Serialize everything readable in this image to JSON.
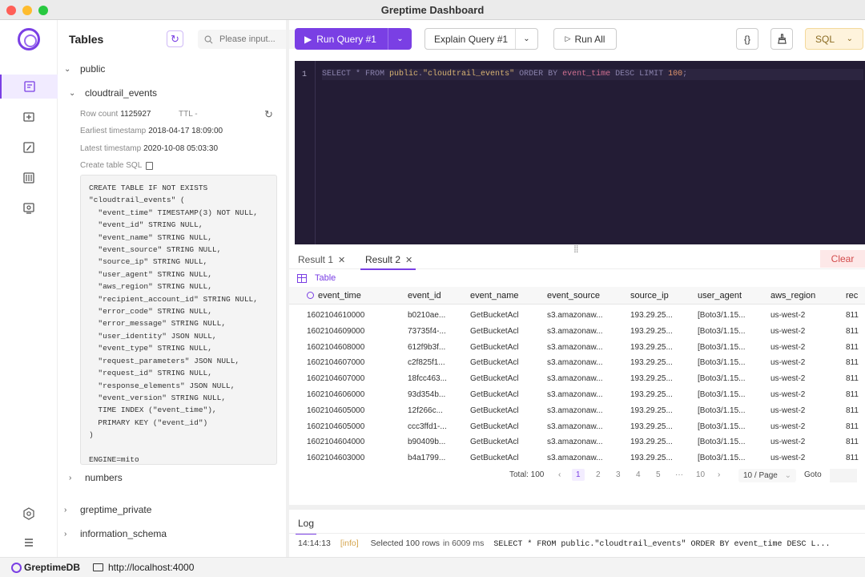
{
  "window": {
    "title": "Greptime Dashboard"
  },
  "sidebar": {
    "title": "Tables",
    "search_placeholder": "Please input...",
    "db_public": "public",
    "table_name": "cloudtrail_events",
    "row_count_label": "Row count",
    "row_count": "1125927",
    "ttl_label": "TTL",
    "ttl": "-",
    "earliest_label": "Earliest timestamp",
    "earliest": "2018-04-17 18:09:00",
    "latest_label": "Latest timestamp",
    "latest": "2020-10-08 05:03:30",
    "create_sql_label": "Create table SQL",
    "create_sql": "CREATE TABLE IF NOT EXISTS\n\"cloudtrail_events\" (\n  \"event_time\" TIMESTAMP(3) NOT NULL,\n  \"event_id\" STRING NULL,\n  \"event_name\" STRING NULL,\n  \"event_source\" STRING NULL,\n  \"source_ip\" STRING NULL,\n  \"user_agent\" STRING NULL,\n  \"aws_region\" STRING NULL,\n  \"recipient_account_id\" STRING NULL,\n  \"error_code\" STRING NULL,\n  \"error_message\" STRING NULL,\n  \"user_identity\" JSON NULL,\n  \"event_type\" STRING NULL,\n  \"request_parameters\" JSON NULL,\n  \"request_id\" STRING NULL,\n  \"response_elements\" JSON NULL,\n  \"event_version\" STRING NULL,\n  TIME INDEX (\"event_time\"),\n  PRIMARY KEY (\"event_id\")\n)\n\nENGINE=mito",
    "table_numbers": "numbers",
    "db_greptime_private": "greptime_private",
    "db_information_schema": "information_schema"
  },
  "toolbar": {
    "run_query": "Run Query #1",
    "explain_query": "Explain Query #1",
    "run_all": "Run All",
    "format_icon": "{}",
    "language": "SQL"
  },
  "editor": {
    "line_number": "1",
    "tokens": {
      "kw1": "SELECT * FROM ",
      "schema": "public",
      "dot": ".",
      "table": "\"cloudtrail_events\"",
      "kw2": " ORDER BY ",
      "field": "event_time",
      "kw3": " DESC LIMIT ",
      "limit": "100",
      "semi": ";"
    }
  },
  "results": {
    "tabs": [
      "Result 1",
      "Result 2"
    ],
    "active_tab": "Result 2",
    "clear": "Clear",
    "view_mode": "Table",
    "columns": [
      "event_time",
      "event_id",
      "event_name",
      "event_source",
      "source_ip",
      "user_agent",
      "aws_region",
      "rec"
    ],
    "rows": [
      [
        "1602104610000",
        "b0210ae...",
        "GetBucketAcl",
        "s3.amazonaw...",
        "193.29.25...",
        "[Boto3/1.15...",
        "us-west-2",
        "811"
      ],
      [
        "1602104609000",
        "73735f4-...",
        "GetBucketAcl",
        "s3.amazonaw...",
        "193.29.25...",
        "[Boto3/1.15...",
        "us-west-2",
        "811"
      ],
      [
        "1602104608000",
        "612f9b3f...",
        "GetBucketAcl",
        "s3.amazonaw...",
        "193.29.25...",
        "[Boto3/1.15...",
        "us-west-2",
        "811"
      ],
      [
        "1602104607000",
        "c2f825f1...",
        "GetBucketAcl",
        "s3.amazonaw...",
        "193.29.25...",
        "[Boto3/1.15...",
        "us-west-2",
        "811"
      ],
      [
        "1602104607000",
        "18fcc463...",
        "GetBucketAcl",
        "s3.amazonaw...",
        "193.29.25...",
        "[Boto3/1.15...",
        "us-west-2",
        "811"
      ],
      [
        "1602104606000",
        "93d354b...",
        "GetBucketAcl",
        "s3.amazonaw...",
        "193.29.25...",
        "[Boto3/1.15...",
        "us-west-2",
        "811"
      ],
      [
        "1602104605000",
        "12f266c...",
        "GetBucketAcl",
        "s3.amazonaw...",
        "193.29.25...",
        "[Boto3/1.15...",
        "us-west-2",
        "811"
      ],
      [
        "1602104605000",
        "ccc3ffd1-...",
        "GetBucketAcl",
        "s3.amazonaw...",
        "193.29.25...",
        "[Boto3/1.15...",
        "us-west-2",
        "811"
      ],
      [
        "1602104604000",
        "b90409b...",
        "GetBucketAcl",
        "s3.amazonaw...",
        "193.29.25...",
        "[Boto3/1.15...",
        "us-west-2",
        "811"
      ],
      [
        "1602104603000",
        "b4a1799...",
        "GetBucketAcl",
        "s3.amazonaw...",
        "193.29.25...",
        "[Boto3/1.15...",
        "us-west-2",
        "811"
      ]
    ],
    "pagination": {
      "total": "Total: 100",
      "pages": [
        "1",
        "2",
        "3",
        "4",
        "5",
        "···",
        "10"
      ],
      "current": "1",
      "page_size": "10 / Page",
      "goto": "Goto"
    }
  },
  "log": {
    "tab": "Log",
    "time": "14:14:13",
    "level": "[info]",
    "message": "Selected 100 rows",
    "duration": "in 6009 ms",
    "sql": "SELECT * FROM public.\"cloudtrail_events\" ORDER BY event_time DESC L..."
  },
  "statusbar": {
    "brand": "GreptimeDB",
    "host": "http://localhost:4000"
  },
  "colors": {
    "accent": "#7a3fe4",
    "editor_bg": "#231c35",
    "sql_badge": "#fef3dc",
    "clear_bg": "#fde8e8"
  }
}
